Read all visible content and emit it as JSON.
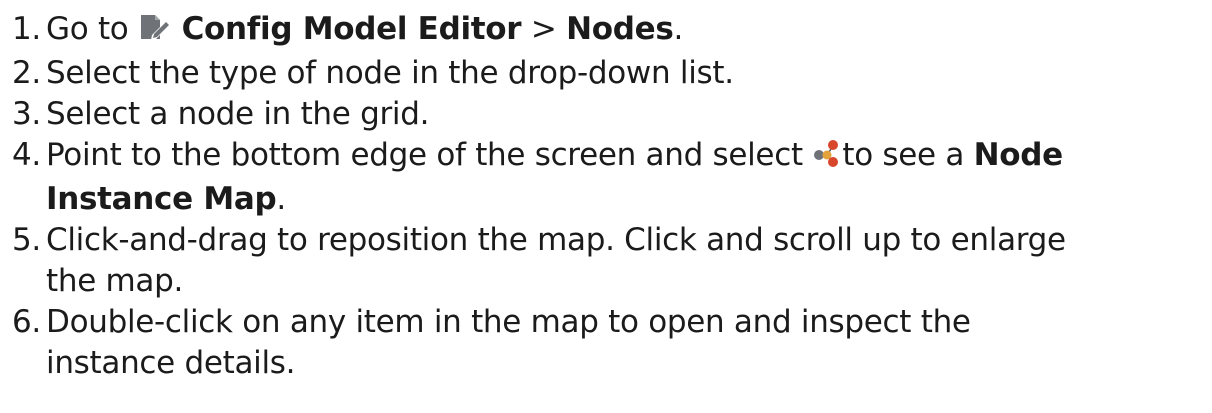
{
  "steps": [
    {
      "num": "1.",
      "prefix": "Go to ",
      "icon": "editor-pencil-icon",
      "bold1": "Config Model Editor",
      "sep": " > ",
      "bold2": "Nodes",
      "suffix": "."
    },
    {
      "num": "2.",
      "text": "Select the type of node in the drop-down list."
    },
    {
      "num": "3.",
      "text": "Select a node in the grid."
    },
    {
      "num": "4.",
      "prefix": "Point to the bottom edge of the screen and select ",
      "icon": "node-instance-map-icon",
      "middle": "to see a ",
      "bold1": "Node",
      "bold2": "Instance Map",
      "suffix": "."
    },
    {
      "num": "5.",
      "line1": "Click-and-drag to reposition the map. Click and scroll up to enlarge",
      "line2": "the map."
    },
    {
      "num": "6.",
      "line1": "Double-click on any item in the map to open and inspect the",
      "line2": "instance details."
    }
  ],
  "colors": {
    "text": "#1b1b1b",
    "icon_gray": "#6f7378",
    "icon_red": "#d8462c"
  }
}
